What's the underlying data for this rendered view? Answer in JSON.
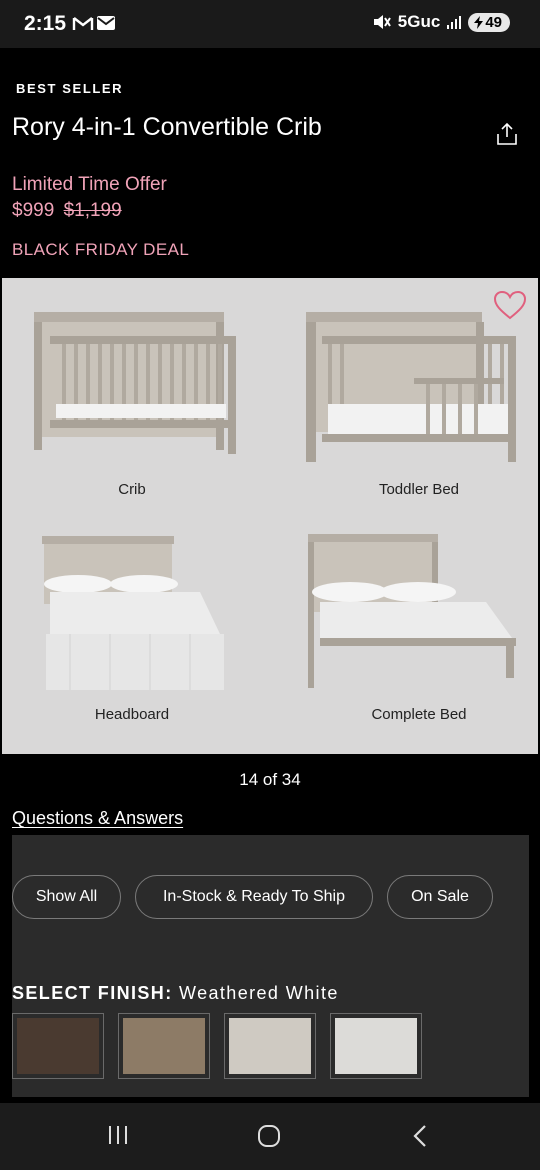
{
  "status_bar": {
    "time": "2:15",
    "network": "5Guc",
    "battery": "49"
  },
  "product": {
    "eyebrow": "BEST SELLER",
    "title": "Rory 4-in-1 Convertible Crib",
    "offer_label": "Limited Time Offer",
    "price": "$999",
    "was_price": "$1,199",
    "deal_label": "BLACK FRIDAY DEAL"
  },
  "gallery": {
    "captions": [
      "Crib",
      "Toddler Bed",
      "Headboard",
      "Complete Bed"
    ],
    "counter": "14 of 34"
  },
  "qa_link": "Questions & Answers",
  "filters": [
    "Show All",
    "In-Stock & Ready To Ship",
    "On Sale"
  ],
  "finish": {
    "label": "SELECT FINISH:",
    "value": "Weathered White",
    "swatch_colors": [
      "#4a3a30",
      "#8d7b66",
      "#cfcac2",
      "#dcdbd8"
    ]
  },
  "colors": {
    "accent": "#f0a3b8"
  }
}
